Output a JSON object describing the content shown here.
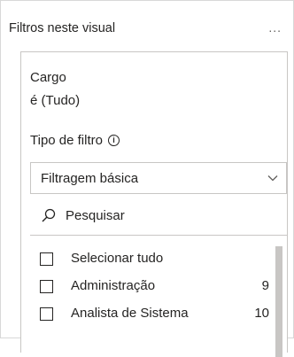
{
  "panel": {
    "title": "Filtros neste visual",
    "more_label": "..."
  },
  "filter_card": {
    "field_name": "Cargo",
    "summary": "é (Tudo)",
    "filter_type_label": "Tipo de filtro",
    "info_glyph": "i",
    "filter_type_value": "Filtragem básica",
    "search_placeholder": "Pesquisar",
    "items": [
      {
        "label": "Selecionar tudo",
        "count": "",
        "checked": false
      },
      {
        "label": "Administração",
        "count": "9",
        "checked": false
      },
      {
        "label": "Analista de Sistema",
        "count": "10",
        "checked": false
      }
    ]
  },
  "colors": {
    "border": "#c8c6c4",
    "text": "#252423",
    "scrollbar": "#c8c6c4"
  },
  "icons": [
    "more-icon",
    "info-icon",
    "chevron-down-icon",
    "search-icon",
    "checkbox-icon"
  ]
}
